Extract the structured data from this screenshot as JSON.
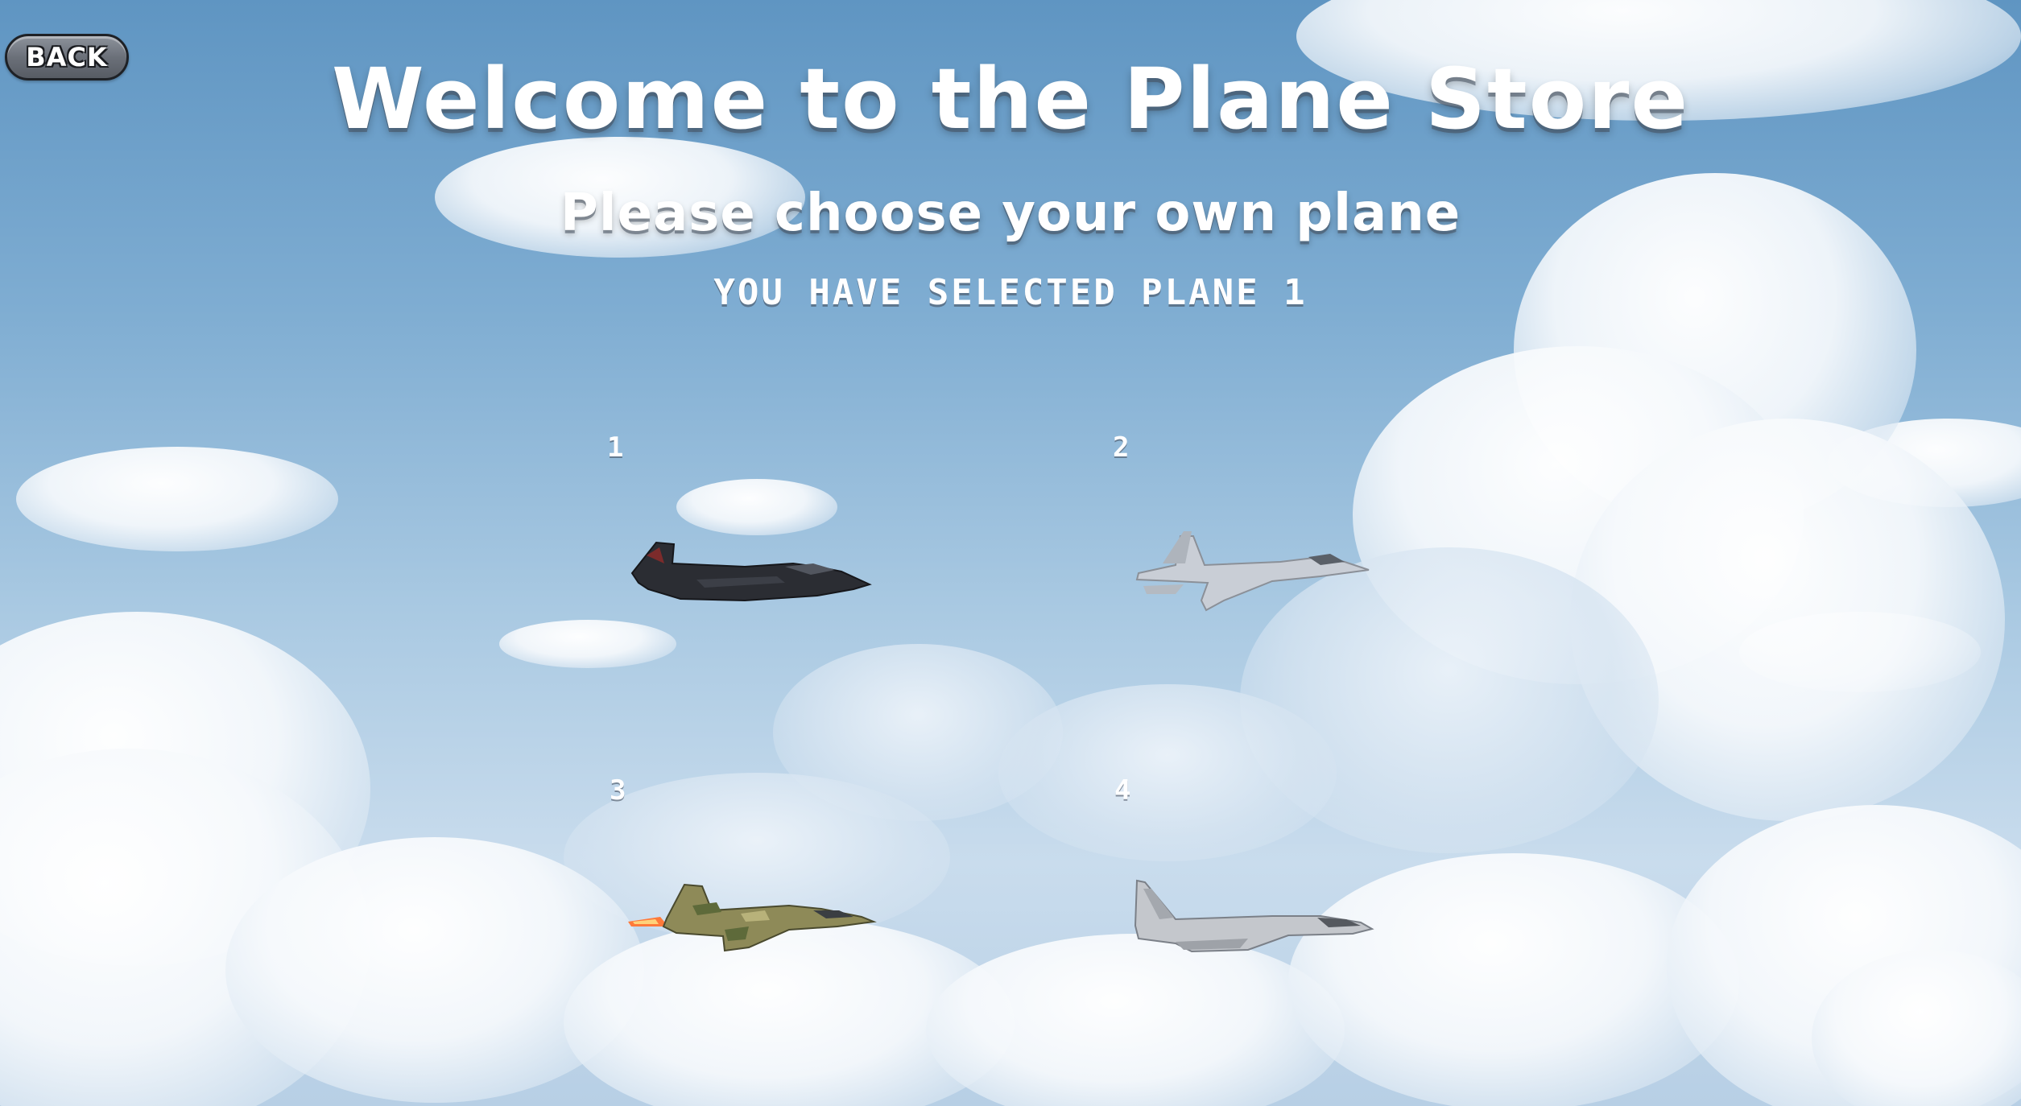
{
  "header": {
    "back_label": "BACK",
    "title": "Welcome to the Plane Store",
    "subtitle": "Please choose your own plane",
    "status": "YOU HAVE SELECTED PLANE 1"
  },
  "planes": [
    {
      "number": "1",
      "icon": "stealth-jet-icon",
      "color": "#2b2d33"
    },
    {
      "number": "2",
      "icon": "fighter-jet-icon",
      "color": "#c9ced6"
    },
    {
      "number": "3",
      "icon": "camo-jet-icon",
      "color": "#8e8a58"
    },
    {
      "number": "4",
      "icon": "silver-jet-icon",
      "color": "#c4c7cc"
    }
  ],
  "selected_plane": 1
}
